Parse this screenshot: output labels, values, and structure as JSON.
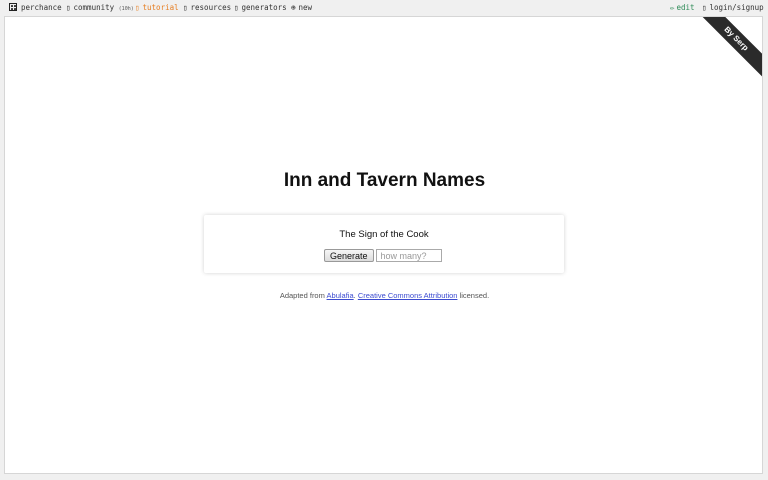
{
  "topbar": {
    "brand": "perchance",
    "community_label": "community",
    "community_count": "(10h)",
    "tutorial": "tutorial",
    "resources": "resources",
    "generators": "generators",
    "new_label": "new",
    "edit": "edit",
    "login": "login/signup"
  },
  "ribbon": "By Serp",
  "page": {
    "title": "Inn and Tavern Names",
    "result": "The Sign of the Cook",
    "generate_label": "Generate",
    "count_placeholder": "how many?"
  },
  "footer": {
    "prefix": "Adapted from",
    "link1": "Abulafia",
    "sep": ".",
    "link2": "Creative Commons Attribution",
    "suffix": "licensed."
  },
  "colors": {
    "tutorial": "#e67e22",
    "edit": "#2e8b57",
    "link": "#3b4bd0",
    "ribbon": "#2b2b2b"
  }
}
